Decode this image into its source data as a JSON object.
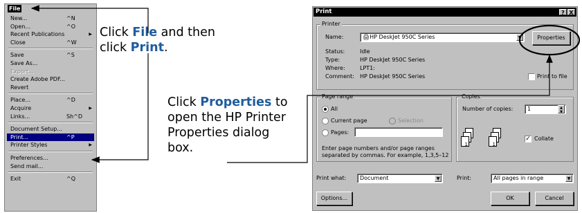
{
  "menu": {
    "title": "File",
    "items": [
      {
        "label": "New...",
        "shortcut": "^N"
      },
      {
        "label": "Open...",
        "shortcut": "^O"
      },
      {
        "label": "Recent Publications",
        "shortcut": "▶"
      },
      {
        "label": "Close",
        "shortcut": "^W"
      },
      {
        "label": "Save",
        "shortcut": "^S"
      },
      {
        "label": "Save As..."
      },
      {
        "label": "Export..."
      },
      {
        "label": "Create Adobe PDF..."
      },
      {
        "label": "Revert"
      },
      {
        "label": "Place...",
        "shortcut": "^D"
      },
      {
        "label": "Acquire",
        "shortcut": "▶"
      },
      {
        "label": "Links...",
        "shortcut": "Sh^D"
      },
      {
        "label": "Document Setup..."
      },
      {
        "label": "Print...",
        "shortcut": "^P"
      },
      {
        "label": "Printer Styles",
        "shortcut": "▶"
      },
      {
        "label": "Preferences..."
      },
      {
        "label": "Send mail..."
      },
      {
        "label": "Exit",
        "shortcut": "^Q"
      }
    ]
  },
  "instructions": {
    "step1": {
      "pre": "Click ",
      "hl1": "File",
      "mid": " and then",
      "line2": "click ",
      "hl2": "Print",
      "end": "."
    },
    "step2": {
      "hl": "Properties",
      "l1_end": " to",
      "l2": "open the HP Printer",
      "l3": "Properties dialog",
      "l4": "box."
    }
  },
  "dialog": {
    "title": "Print",
    "help": "?",
    "close": "X",
    "printer_group": "Printer",
    "name_label": "Name:",
    "name_value": "HP DeskJet 950C Series",
    "properties_button": "Properties",
    "status_label": "Status:",
    "status_value": "Idle",
    "type_label": "Type:",
    "type_value": "HP DeskJet 950C Series",
    "where_label": "Where:",
    "where_value": "LPT1:",
    "comment_label": "Comment:",
    "comment_value": "HP DeskJet 950C Series",
    "print_to_file": "Print to file",
    "range_group": "Page range",
    "all": "All",
    "current_page": "Current page",
    "selection": "Selection",
    "pages": "Pages:",
    "hint1": "Enter page numbers and/or page ranges",
    "hint2": "separated by commas.  For example, 1,3,5–12",
    "copies_group": "Copies",
    "num_copies_label": "Number of copies:",
    "num_copies_value": "1",
    "collate": "Collate",
    "print_what_label": "Print what:",
    "print_what_value": "Document",
    "print_label": "Print:",
    "print_value": "All pages in range",
    "options_button": "Options...",
    "ok_button": "OK",
    "cancel_button": "Cancel"
  }
}
